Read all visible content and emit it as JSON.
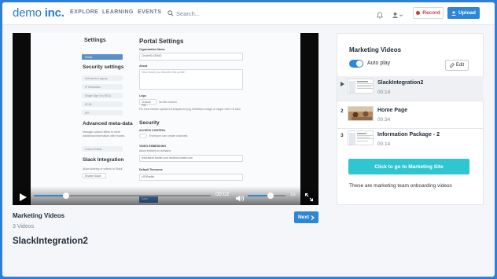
{
  "header": {
    "logo_light": "demo",
    "logo_bold": "inc.",
    "nav": [
      "EXPLORE",
      "LEARNING",
      "EVENTS"
    ],
    "search_placeholder": "Search...",
    "record_label": "Record",
    "upload_label": "Upload"
  },
  "player": {
    "time": "00:02",
    "speed": "1x",
    "progress_fraction": 0.18,
    "volume_fraction": 0.6,
    "screen": {
      "heading_left": "Settings",
      "heading_right": "Portal Settings",
      "sidebar": {
        "selected": "Portal",
        "security_heading": "Security settings",
        "security_items": [
          "Self-service signup",
          "IP Restriction",
          "Single Sign On (SSO)",
          "SCIM",
          "API"
        ],
        "meta_heading": "Advanced meta-data",
        "meta_text": "Manage custom fields to store additional information with modes.",
        "meta_item": "Custom Fields",
        "slack_heading": "Slack Integration",
        "slack_text": "Allow sharing of videos to Slack",
        "slack_button": "Enable Slack"
      },
      "form": {
        "org_label": "Organization Name",
        "org_value": "CircleHD DEMO",
        "about_label": "About",
        "about_placeholder": "How would you describe this portal?",
        "logo_label": "Logo",
        "file_button": "Choose File",
        "file_text": "No file chosen",
        "logo_hint": "For best results upload a transparent png 400x50px image or larger with 1:8 ratio",
        "security_label": "Security",
        "access_label": "ACCESS CONTROL",
        "access_text": "Everyone can create channels",
        "embed_label": "VIDEO EMBEDDING",
        "embed_sub": "Allow embed on domains",
        "embed_value": "test1blewt.tumblr.com  circlehd.tumblr.com",
        "tz_label": "Default Timezone",
        "tz_value": "US/Pacific",
        "save_label": "Save"
      }
    }
  },
  "video": {
    "playlist_title": "Marketing Videos",
    "count_label": "3 Videos",
    "next_label": "Next",
    "current_title": "SlackIntegration2"
  },
  "panel": {
    "title": "Marketing Videos",
    "autoplay_label": "Auto play",
    "autoplay_on": true,
    "edit_label": "Edit",
    "items": [
      {
        "index": "",
        "name": "SlackIntegration2",
        "duration": "00:14"
      },
      {
        "index": "2",
        "name": "Home Page",
        "duration": "00:34"
      },
      {
        "index": "3",
        "name": "Information Package - 2",
        "duration": "00:14"
      }
    ],
    "site_button": "Click to go to Marketing Site",
    "description": "These are marketing team onboarding videos"
  },
  "colors": {
    "accent": "#2e86d6",
    "cta": "#2fc5d1",
    "record": "#d43a3a"
  }
}
